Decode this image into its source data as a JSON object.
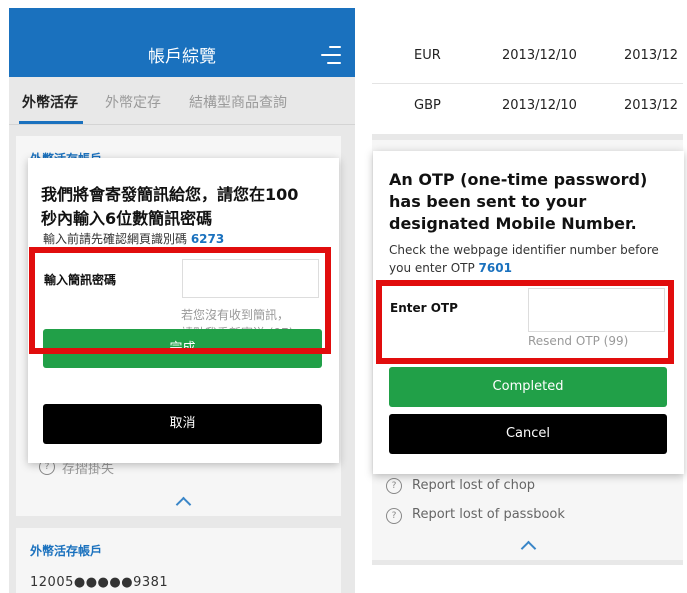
{
  "left": {
    "header": {
      "title": "帳戶綜覽"
    },
    "tabs": [
      {
        "label": "外幣活存"
      },
      {
        "label": "外幣定存"
      },
      {
        "label": "結構型商品查詢"
      }
    ],
    "card1": {
      "title": "外幣活存帳戶",
      "dim_text": "存摺掛失"
    },
    "card2": {
      "title": "外幣活存帳戶",
      "account_number": "12005●●●●●9381"
    },
    "dialog": {
      "message_line1": "我們將會寄發簡訊給您，請您在100",
      "message_line2": "秒內輸入6位數簡訊密碼",
      "note_prefix": "輸入前請先確認網頁識別碼 ",
      "identifier": "6273",
      "otp_label": "輸入簡訊密碼",
      "resend_line1": "若您沒有收到簡訊，",
      "resend_line2": "請點我重新寄送 (97)",
      "confirm_label": "完成",
      "cancel_label": "取消"
    }
  },
  "right": {
    "table": {
      "rows": [
        {
          "currency": "EUR",
          "date": "2013/12/10",
          "date2": "2013/12"
        },
        {
          "currency": "GBP",
          "date": "2013/12/10",
          "date2": "2013/12"
        }
      ]
    },
    "options": [
      {
        "label": "Report lost of chop"
      },
      {
        "label": "Report lost of passbook"
      }
    ],
    "dialog": {
      "message": "An OTP (one-time password) has been sent to your designated Mobile Number.",
      "note_prefix": "Check the webpage identifier number before you enter OTP ",
      "identifier": "7601",
      "otp_label": "Enter OTP",
      "resend_label": "Resend OTP (99)",
      "confirm_label": "Completed",
      "cancel_label": "Cancel"
    }
  },
  "colors": {
    "brand": "#1a71be",
    "confirm": "#21a048",
    "cancel": "#000000",
    "highlight": "#e10d0d"
  },
  "icons": [
    "menu-icon",
    "chevron-up-icon",
    "help-circle-icon"
  ]
}
